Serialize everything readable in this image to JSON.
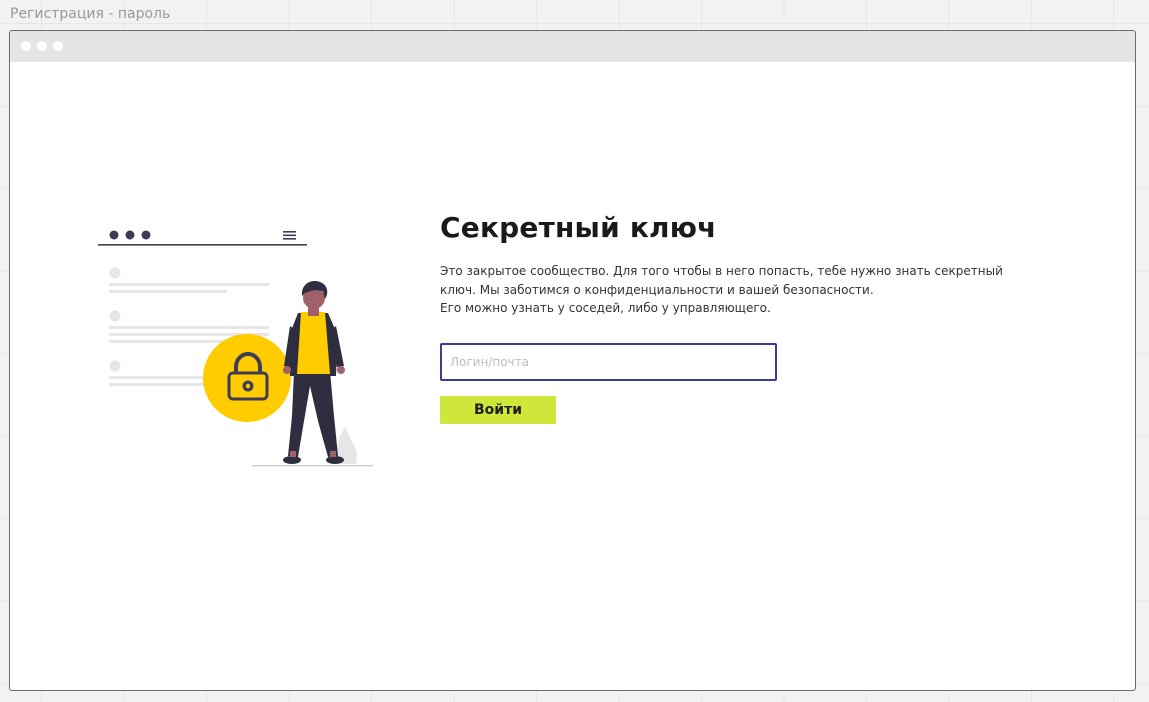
{
  "page_title": "Регистрация - пароль",
  "window": {
    "controls": [
      "window-dot",
      "window-dot",
      "window-dot"
    ]
  },
  "illustration": {
    "icons": [
      "browser-dots-icon",
      "hamburger-menu-icon",
      "padlock-icon",
      "person-figure"
    ]
  },
  "main": {
    "heading": "Секретный ключ",
    "description": [
      "Это закрытое сообщество. Для того чтобы в него попасть, тебе нужно знать секретный",
      "ключ. Мы заботимся о конфиденциальности и вашей безопасности.",
      "Его можно узнать у соседей, либо у управляющего."
    ],
    "login_field": {
      "placeholder": "Логин/почта",
      "value": ""
    },
    "submit_label": "Войти"
  },
  "colors": {
    "accent": "#cfe63a",
    "input_border": "#3c3f8e",
    "lock_yellow": "#ffcc00",
    "figure_dark": "#2f2e41"
  }
}
